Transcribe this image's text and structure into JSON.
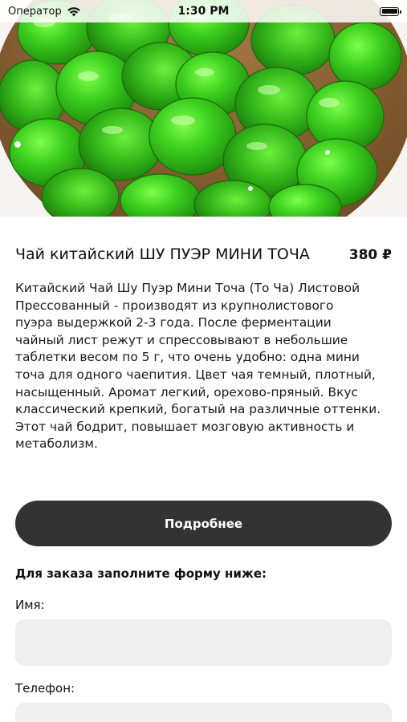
{
  "status_bar": {
    "carrier": "Оператор",
    "time": "1:30 PM"
  },
  "hero": {
    "image_icon": "green-tea-cakes-image"
  },
  "product": {
    "title": "Чай китайский ШУ ПУЭР МИНИ ТОЧА",
    "price": "380 ₽",
    "description_lines": [
      "Китайский Чай Шу Пуэр Мини Точа (То Ча) Листовой",
      "Прессованный - производят из крупнолистового",
      "пуэра выдержкой 2-3 года. После ферментации",
      "чайный лист режут и спрессовывают в небольшие",
      "таблетки весом по 5 г, что очень удобно: одна мини",
      "точа для одного чаепития. Цвет чая темный, плотный,",
      "насыщенный. Аромат легкий, орехово-пряный. Вкус",
      "классический крепкий, богатый на различные оттенки.",
      "Этот чай бодрит, повышает мозговую активность и",
      "метаболизм."
    ]
  },
  "more_button": {
    "label": "Подробнее"
  },
  "order_form": {
    "heading": "Для заказа заполните форму ниже:",
    "name_label": "Имя:",
    "name_value": "",
    "phone_label": "Телефон:",
    "phone_value": ""
  },
  "colors": {
    "button_bg": "#333333",
    "input_bg": "#efefef",
    "foil_green": "#3ccf1f"
  }
}
